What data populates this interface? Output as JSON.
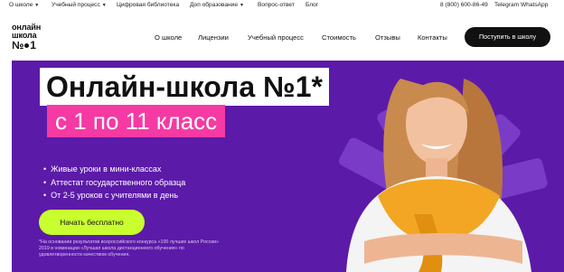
{
  "topbar": {
    "links": [
      {
        "label": "О школе",
        "chevron": true
      },
      {
        "label": "Учебный процесс",
        "chevron": true
      },
      {
        "label": "Цифровая библиотека",
        "chevron": false
      },
      {
        "label": "Доп образование",
        "chevron": true
      },
      {
        "label": "Вопрос-ответ",
        "chevron": false
      },
      {
        "label": "Блог",
        "chevron": false
      }
    ],
    "phone": "8 (800) 600-86-49",
    "messengers": "Telegram WhatsApp"
  },
  "logo": {
    "line1": "онлайн",
    "line2": "школа",
    "line3_a": "№",
    "line3_b": "1"
  },
  "nav": {
    "items": [
      "О школе",
      "Лицензии",
      "Учебный процесс",
      "Стоимость",
      "Отзывы",
      "Контакты"
    ],
    "cta": "Поступить в школу"
  },
  "hero": {
    "title": "Онлайн-школа №1*",
    "subtitle": "с 1 по 11 класс",
    "bullets": [
      "Живые уроки в мини-классах",
      "Аттестат государственного образца",
      "От 2-5 уроков с учителями в день"
    ],
    "button": "Начать бесплатно",
    "footnote": "*На основании результатов всероссийского конкурса «100 лучших школ России» 2019 в номинации «Лучшая школа дистанционного обучения» по удовлетворенности качеством обучения."
  },
  "colors": {
    "hero_bg": "#5c1aa8",
    "accent_pink": "#f53aa3",
    "accent_lime": "#c9ff2e",
    "cta_bg": "#111111"
  }
}
